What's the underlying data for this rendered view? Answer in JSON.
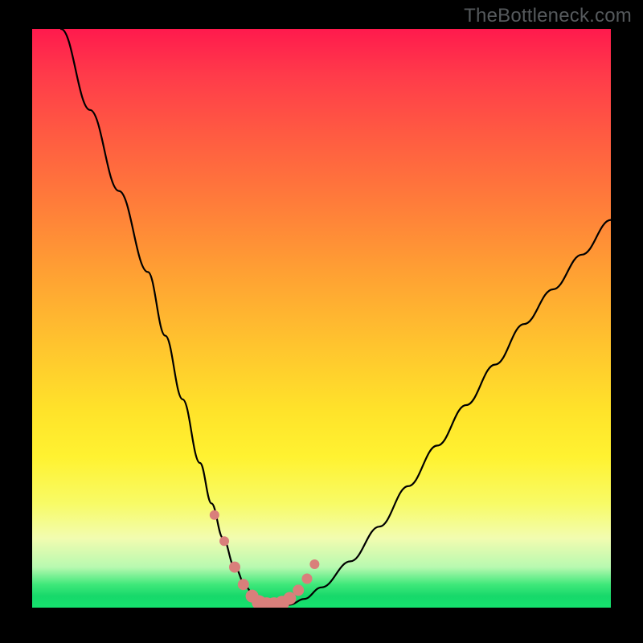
{
  "watermark": "TheBottleneck.com",
  "chart_data": {
    "type": "line",
    "title": "",
    "xlabel": "",
    "ylabel": "",
    "xlim": [
      0,
      100
    ],
    "ylim": [
      0,
      100
    ],
    "grid": false,
    "legend": false,
    "series": [
      {
        "name": "bottleneck-curve",
        "x": [
          5,
          10,
          15,
          20,
          23,
          26,
          29,
          31,
          33,
          35,
          37,
          38.5,
          40,
          42,
          44.5,
          47,
          50,
          55,
          60,
          65,
          70,
          75,
          80,
          85,
          90,
          95,
          100
        ],
        "values": [
          100,
          86,
          72,
          58,
          47,
          36,
          25,
          18,
          12,
          7,
          3.5,
          1.5,
          0.5,
          0.2,
          0.5,
          1.5,
          3.5,
          8,
          14,
          21,
          28,
          35,
          42,
          49,
          55,
          61,
          67
        ]
      }
    ],
    "markers": {
      "name": "highlight-points",
      "color": "#d97f7b",
      "x": [
        31.5,
        33.2,
        35.0,
        36.5,
        38.0,
        39.2,
        40.5,
        41.8,
        43.2,
        44.5,
        46.0,
        47.5,
        48.8
      ],
      "values": [
        16.0,
        11.5,
        7.0,
        4.0,
        2.0,
        0.9,
        0.4,
        0.4,
        0.8,
        1.6,
        3.0,
        5.0,
        7.5
      ],
      "r": [
        6,
        6,
        7,
        7,
        8,
        9,
        10,
        10,
        9,
        8,
        7,
        6.5,
        6
      ]
    },
    "gradient_stops": [
      {
        "pos": 0.0,
        "color": "#ff1a4d"
      },
      {
        "pos": 0.18,
        "color": "#ff5a42"
      },
      {
        "pos": 0.42,
        "color": "#ffa033"
      },
      {
        "pos": 0.66,
        "color": "#ffe32a"
      },
      {
        "pos": 0.85,
        "color": "#f4fc90"
      },
      {
        "pos": 0.95,
        "color": "#4fe880"
      },
      {
        "pos": 1.0,
        "color": "#15e26e"
      }
    ]
  }
}
